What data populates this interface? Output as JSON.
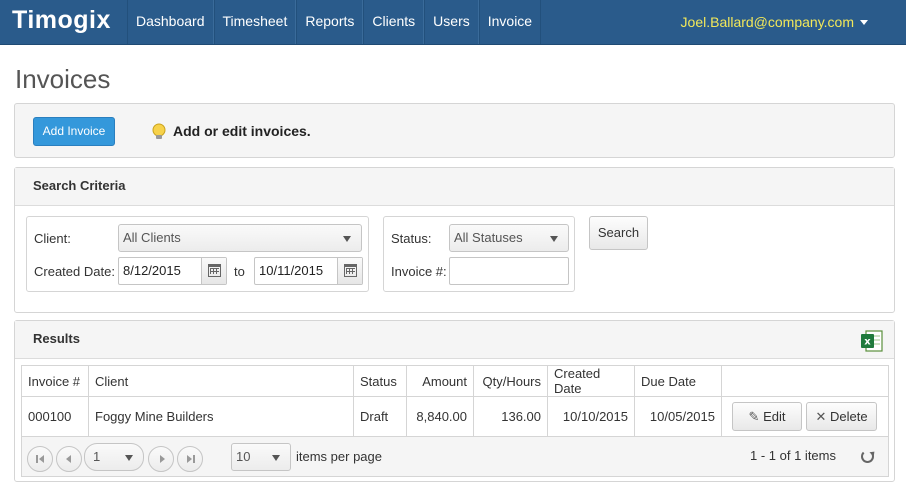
{
  "navbar": {
    "brand": "Timogix",
    "items": [
      "Dashboard",
      "Timesheet",
      "Reports",
      "Clients",
      "Users",
      "Invoice"
    ],
    "user_email": "Joel.Ballard@company.com"
  },
  "page": {
    "title": "Invoices"
  },
  "toolbar": {
    "add_label": "Add Invoice",
    "tip": "Add or edit invoices."
  },
  "search": {
    "heading": "Search Criteria",
    "client_label": "Client:",
    "client_value": "All Clients",
    "created_label": "Created Date:",
    "date_from": "8/12/2015",
    "to_label": "to",
    "date_to": "10/11/2015",
    "status_label": "Status:",
    "status_value": "All Statuses",
    "invoice_label": "Invoice #:",
    "invoice_value": "",
    "search_button": "Search"
  },
  "results": {
    "heading": "Results",
    "columns": [
      "Invoice #",
      "Client",
      "Status",
      "Amount",
      "Qty/Hours",
      "Created Date",
      "Due Date"
    ],
    "rows": [
      {
        "invoice": "000100",
        "client": "Foggy Mine Builders",
        "status": "Draft",
        "amount": "8,840.00",
        "qty": "136.00",
        "created": "10/10/2015",
        "due": "10/05/2015",
        "edit_label": "Edit",
        "delete_label": "Delete"
      }
    ],
    "pager": {
      "page": "1",
      "page_size": "10",
      "per_page_label": "items per page",
      "summary": "1 - 1 of 1 items"
    }
  },
  "colors": {
    "navbar": "#2a5b8b",
    "user_email": "#f2e85a",
    "primary": "#3498db"
  }
}
